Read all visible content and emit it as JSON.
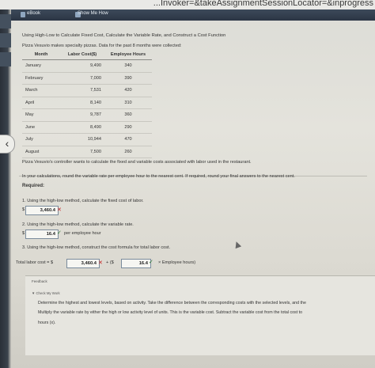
{
  "browser": {
    "url_fragment": "...Invoker=&takeAssignmentSessionLocator=&inprogress"
  },
  "toolbar": {
    "ebook": "eBook",
    "show_me_how": "Show Me How"
  },
  "problem": {
    "title": "Using High-Low to Calculate Fixed Cost, Calculate the Variable Rate, and Construct a Cost Function",
    "intro": "Pizza Vesuvio makes specialty pizzas. Data for the past 8 months were collected:",
    "table": {
      "headers": [
        "Month",
        "Labor Cost($)",
        "Employee Hours"
      ],
      "rows": [
        [
          "January",
          "9,490",
          "340"
        ],
        [
          "February",
          "7,000",
          "390"
        ],
        [
          "March",
          "7,531",
          "420"
        ],
        [
          "April",
          "8,140",
          "310"
        ],
        [
          "May",
          "9,787",
          "360"
        ],
        [
          "June",
          "8,490",
          "290"
        ],
        [
          "July",
          "10,944",
          "470"
        ],
        [
          "August",
          "7,500",
          "260"
        ]
      ]
    },
    "para1": "Pizza Vesuvio's controller wants to calculate the fixed and variable costs associated with labor used in the restaurant.",
    "para2": "In your calculations, round the variable rate per employee hour to the nearest cent. If required, round your final answers to the nearest cent.",
    "required_label": "Required:",
    "q1": "1. Using the high-low method, calculate the fixed cost of labor.",
    "q1_prefix": "$",
    "q1_answer": "3,460.4",
    "q1_mark": "✕",
    "q2": "2. Using the high-low method, calculate the variable rate.",
    "q2_prefix": "$",
    "q2_answer": "16.4",
    "q2_mark": "✓",
    "q2_suffix": "per employee hour",
    "q3": "3. Using the high-low method, construct the cost formula for total labor cost.",
    "q3_lead": "Total labor cost = $",
    "q3_fixed": "3,460.4",
    "q3_fixed_mark": "✕",
    "q3_plus": "+ ($",
    "q3_rate": "16.4",
    "q3_rate_mark": "✓",
    "q3_tail": "× Employee hours)"
  },
  "feedback": {
    "header": "Feedback",
    "check_my_work": "▼ Check My Work",
    "lines": [
      "Determine the highest and lowest levels, based on activity. Take the difference between the corresponding costs with the selected levels, and the",
      "Multiply the variable rate by either the high or low activity level of units. This is the variable cost. Subtract the variable cost from the total cost to",
      "hours (x)."
    ]
  },
  "colors": {
    "incorrect": "#c62828",
    "correct": "#2e7d32",
    "toolbar": "#2b3544"
  }
}
